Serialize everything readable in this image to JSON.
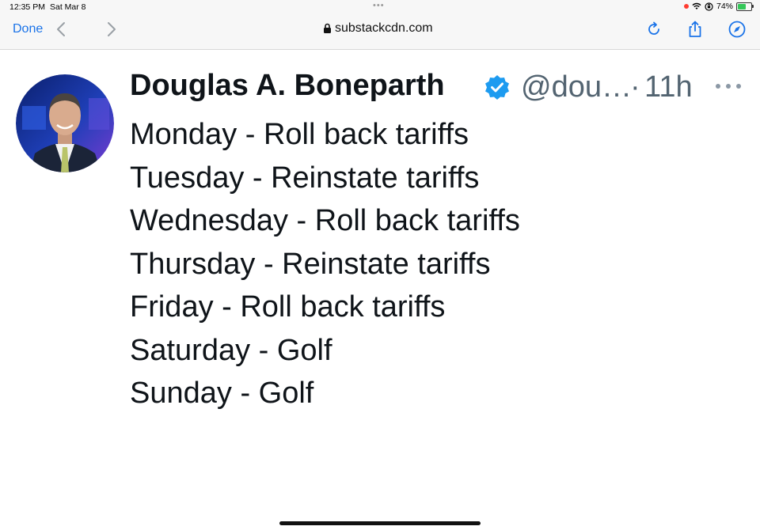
{
  "status_bar": {
    "time": "12:35 PM",
    "date": "Sat Mar 8",
    "dots": "•••",
    "battery_text": "74%",
    "battery_level": 0.74,
    "icons": [
      "record-dot-icon",
      "wifi-icon",
      "orientation-lock-icon",
      "battery-charging-icon"
    ]
  },
  "toolbar": {
    "done_label": "Done",
    "url": "substackcdn.com",
    "icons": [
      "chevron-left-icon",
      "chevron-right-icon",
      "lock-icon",
      "reload-icon",
      "share-icon",
      "compass-icon"
    ],
    "accent_color": "#1a73e8"
  },
  "tweet": {
    "author_name": "Douglas A. Boneparth",
    "handle": "@dou…",
    "separator": "·",
    "time": "11h",
    "verified_color": "#1d9bf0",
    "lines": [
      "Monday - Roll back tariffs",
      "Tuesday - Reinstate tariffs",
      "Wednesday - Roll back tariffs",
      "Thursday - Reinstate tariffs",
      "Friday - Roll back tariffs",
      "Saturday - Golf",
      "Sunday - Golf"
    ]
  }
}
